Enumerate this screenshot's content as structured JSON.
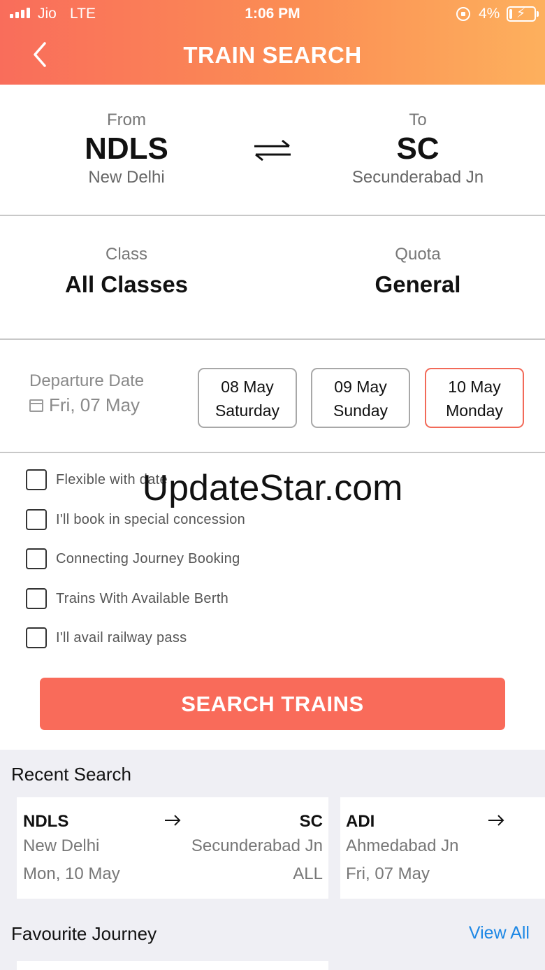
{
  "status_bar": {
    "carrier": "Jio",
    "network": "LTE",
    "time": "1:06 PM",
    "battery_percent": "4%"
  },
  "header": {
    "title": "TRAIN SEARCH",
    "back_icon": "chevron-left-icon"
  },
  "route": {
    "from_label": "From",
    "from_code": "NDLS",
    "from_name": "New Delhi",
    "swap_icon": "swap-arrows-icon",
    "to_label": "To",
    "to_code": "SC",
    "to_name": "Secunderabad Jn"
  },
  "class_quota": {
    "class_label": "Class",
    "class_value": "All Classes",
    "quota_label": "Quota",
    "quota_value": "General"
  },
  "departure": {
    "label": "Departure Date",
    "date": "Fri, 07 May",
    "calendar_icon": "calendar-icon",
    "chips": [
      {
        "date": "08 May",
        "day": "Saturday",
        "selected": false
      },
      {
        "date": "09 May",
        "day": "Sunday",
        "selected": false
      },
      {
        "date": "10 May",
        "day": "Monday",
        "selected": true
      }
    ]
  },
  "options": [
    {
      "label": "Flexible with date",
      "checked": false
    },
    {
      "label": "I'll book in special concession",
      "checked": false
    },
    {
      "label": "Connecting Journey Booking",
      "checked": false
    },
    {
      "label": "Trains With Available Berth",
      "checked": false
    },
    {
      "label": "I'll avail railway pass",
      "checked": false
    }
  ],
  "watermark": "UpdateStar.com",
  "search_button": "SEARCH TRAINS",
  "recent": {
    "title": "Recent Search",
    "cards": [
      {
        "from_code": "NDLS",
        "from_name": "New Delhi",
        "to_code": "SC",
        "to_name": "Secunderabad Jn",
        "date": "Mon, 10 May",
        "class": "ALL"
      },
      {
        "from_code": "ADI",
        "from_name": "Ahmedabad Jn",
        "date": "Fri, 07 May"
      }
    ]
  },
  "favourite": {
    "title": "Favourite Journey",
    "view_all": "View All"
  },
  "colors": {
    "header_start": "#f96d5b",
    "header_end": "#fdb05d",
    "accent": "#f96b5a",
    "link": "#1e88e5",
    "background_grey": "#efeff4"
  }
}
